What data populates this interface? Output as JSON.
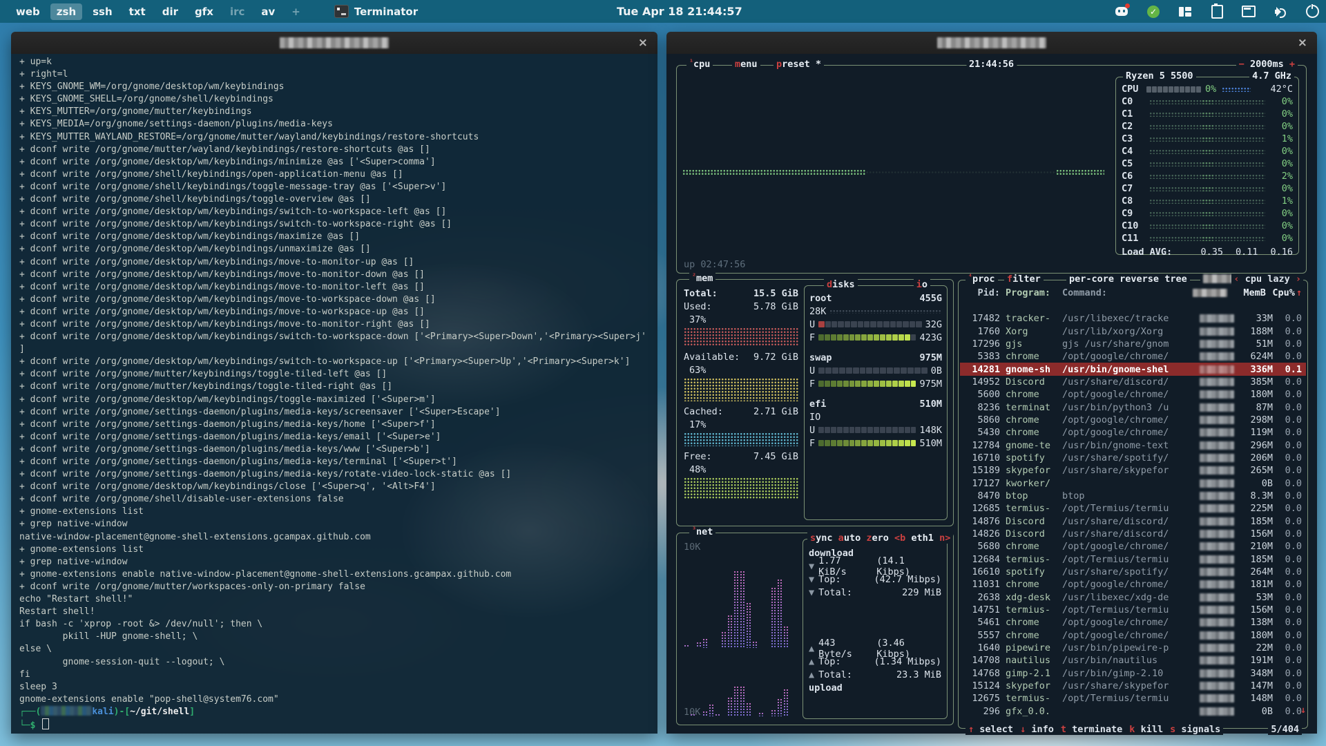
{
  "topbar": {
    "workspaces": [
      {
        "label": "web"
      },
      {
        "label": "zsh",
        "active": true
      },
      {
        "label": "ssh"
      },
      {
        "label": "txt"
      },
      {
        "label": "dir"
      },
      {
        "label": "gfx"
      },
      {
        "label": "irc",
        "dim": true
      },
      {
        "label": "av"
      },
      {
        "label": "+",
        "dim": true
      }
    ],
    "app_title": "Terminator",
    "clock": "Tue Apr 18  21:44:57",
    "tray_icons": [
      "discord-icon",
      "updates-ok-icon",
      "tiling-layout-icon",
      "clipboard-icon",
      "terminal-icon",
      "volume-icon",
      "power-icon"
    ]
  },
  "left_terminal": {
    "close_label": "×",
    "lines": [
      "+ up=k",
      "+ right=l",
      "+ KEYS_GNOME_WM=/org/gnome/desktop/wm/keybindings",
      "+ KEYS_GNOME_SHELL=/org/gnome/shell/keybindings",
      "+ KEYS_MUTTER=/org/gnome/mutter/keybindings",
      "+ KEYS_MEDIA=/org/gnome/settings-daemon/plugins/media-keys",
      "+ KEYS_MUTTER_WAYLAND_RESTORE=/org/gnome/mutter/wayland/keybindings/restore-shortcuts",
      "+ dconf write /org/gnome/mutter/wayland/keybindings/restore-shortcuts @as []",
      "+ dconf write /org/gnome/desktop/wm/keybindings/minimize @as ['<Super>comma']",
      "+ dconf write /org/gnome/shell/keybindings/open-application-menu @as []",
      "+ dconf write /org/gnome/shell/keybindings/toggle-message-tray @as ['<Super>v']",
      "+ dconf write /org/gnome/shell/keybindings/toggle-overview @as []",
      "+ dconf write /org/gnome/desktop/wm/keybindings/switch-to-workspace-left @as []",
      "+ dconf write /org/gnome/desktop/wm/keybindings/switch-to-workspace-right @as []",
      "+ dconf write /org/gnome/desktop/wm/keybindings/maximize @as []",
      "+ dconf write /org/gnome/desktop/wm/keybindings/unmaximize @as []",
      "+ dconf write /org/gnome/desktop/wm/keybindings/move-to-monitor-up @as []",
      "+ dconf write /org/gnome/desktop/wm/keybindings/move-to-monitor-down @as []",
      "+ dconf write /org/gnome/desktop/wm/keybindings/move-to-monitor-left @as []",
      "+ dconf write /org/gnome/desktop/wm/keybindings/move-to-workspace-down @as []",
      "+ dconf write /org/gnome/desktop/wm/keybindings/move-to-workspace-up @as []",
      "+ dconf write /org/gnome/desktop/wm/keybindings/move-to-monitor-right @as []",
      "+ dconf write /org/gnome/desktop/wm/keybindings/switch-to-workspace-down ['<Primary><Super>Down','<Primary><Super>j'",
      "]",
      "+ dconf write /org/gnome/desktop/wm/keybindings/switch-to-workspace-up ['<Primary><Super>Up','<Primary><Super>k']",
      "+ dconf write /org/gnome/mutter/keybindings/toggle-tiled-left @as []",
      "+ dconf write /org/gnome/mutter/keybindings/toggle-tiled-right @as []",
      "+ dconf write /org/gnome/desktop/wm/keybindings/toggle-maximized ['<Super>m']",
      "+ dconf write /org/gnome/settings-daemon/plugins/media-keys/screensaver ['<Super>Escape']",
      "+ dconf write /org/gnome/settings-daemon/plugins/media-keys/home ['<Super>f']",
      "+ dconf write /org/gnome/settings-daemon/plugins/media-keys/email ['<Super>e']",
      "+ dconf write /org/gnome/settings-daemon/plugins/media-keys/www ['<Super>b']",
      "+ dconf write /org/gnome/settings-daemon/plugins/media-keys/terminal ['<Super>t']",
      "+ dconf write /org/gnome/settings-daemon/plugins/media-keys/rotate-video-lock-static @as []",
      "+ dconf write /org/gnome/desktop/wm/keybindings/close ['<Super>q', '<Alt>F4']",
      "+ dconf write /org/gnome/shell/disable-user-extensions false",
      "+ gnome-extensions list",
      "+ grep native-window",
      "native-window-placement@gnome-shell-extensions.gcampax.github.com",
      "+ gnome-extensions list",
      "+ grep native-window",
      "+ gnome-extensions enable native-window-placement@gnome-shell-extensions.gcampax.github.com",
      "+ dconf write /org/gnome/mutter/workspaces-only-on-primary false",
      "echo \"Restart shell!\"",
      "Restart shell!",
      "if bash -c 'xprop -root &> /dev/null'; then \\",
      "        pkill -HUP gnome-shell; \\",
      "else \\",
      "        gnome-session-quit --logout; \\",
      "fi",
      "sleep 3",
      "gnome-extensions enable \"pop-shell@system76.com\""
    ],
    "prompt": {
      "frame_open": "┌──(",
      "host": "kali",
      "sep": ")-[",
      "path": "~/git/shell",
      "close_bracket": "]",
      "frame_bottom": "└─$"
    }
  },
  "btop": {
    "cpu": {
      "num": "¹",
      "title": "cpu",
      "menu_key": "m",
      "menu_rest": "enu",
      "preset_key": "p",
      "preset_rest": "reset *",
      "clock": "21:44:56",
      "interval_minus": "−",
      "interval": "2000ms",
      "interval_plus": "+",
      "model": "Ryzen 5 5500",
      "freq": "4.7 GHz",
      "cpu_label": "CPU",
      "cpu_pct": "0%",
      "temp": "42°C",
      "cores": [
        {
          "label": "C0",
          "pct": "0%"
        },
        {
          "label": "C1",
          "pct": "0%"
        },
        {
          "label": "C2",
          "pct": "0%"
        },
        {
          "label": "C3",
          "pct": "1%"
        },
        {
          "label": "C4",
          "pct": "0%"
        },
        {
          "label": "C5",
          "pct": "0%"
        },
        {
          "label": "C6",
          "pct": "2%"
        },
        {
          "label": "C7",
          "pct": "0%"
        },
        {
          "label": "C8",
          "pct": "1%"
        },
        {
          "label": "C9",
          "pct": "0%"
        },
        {
          "label": "C10",
          "pct": "0%"
        },
        {
          "label": "C11",
          "pct": "0%"
        }
      ],
      "load_label": "Load AVG:",
      "load": [
        "0.35",
        "0.11",
        "0.16"
      ],
      "uptime": "up 02:47:56"
    },
    "mem": {
      "num": "²",
      "title": "mem",
      "entries": [
        {
          "label": "Total:",
          "value": "15.5 GiB",
          "bold": true
        },
        {
          "label": "Used:",
          "value": "5.78 GiB",
          "pct": "37%",
          "color": "#c15959",
          "gh": 28
        },
        {
          "label": "Available:",
          "value": "9.72 GiB",
          "pct": "63%",
          "color": "#cdbd5e",
          "gh": 34
        },
        {
          "label": "Cached:",
          "value": "2.71 GiB",
          "pct": "17%",
          "color": "#5fb6cf",
          "gh": 20
        },
        {
          "label": "Free:",
          "value": "7.45 GiB",
          "pct": "48%",
          "color": "#a8c95c",
          "gh": 32
        }
      ]
    },
    "disks": {
      "title_key": "d",
      "title_rest": "isks",
      "io_key": "i",
      "io_rest": "o",
      "items": [
        {
          "name": "root",
          "size": "455G",
          "io": "28K",
          "io_dots": true,
          "used_value": "32G",
          "used_fill": 0.07,
          "free_value": "423G",
          "free_fill": 0.93
        },
        {
          "name": "swap",
          "size": "975M",
          "io": null,
          "used_value": "0B",
          "used_fill": 0.0,
          "free_value": "975M",
          "free_fill": 1.0
        },
        {
          "name": "efi",
          "size": "510M",
          "io": "IO",
          "io_dots": false,
          "used_value": "148K",
          "used_fill": 0.0,
          "free_value": "510M",
          "free_fill": 1.0
        }
      ],
      "u_label": "U",
      "f_label": "F"
    },
    "net": {
      "num": "³",
      "title": "net",
      "scale_top": "10K",
      "scale_bottom": "10K",
      "buttons": [
        {
          "key": "s",
          "rest": "ync"
        },
        {
          "key": "a",
          "rest": "uto"
        },
        {
          "key": "z",
          "rest": "ero"
        }
      ],
      "iface_left": "<b",
      "iface": "eth1",
      "iface_right": "n>",
      "download_label": "download",
      "upload_label": "upload",
      "down_stats": [
        {
          "arrow": "▼",
          "a": "1.77 KiB/s",
          "b": "(14.1 Kibps)"
        },
        {
          "arrow": "▼",
          "a": "Top:",
          "b": "(42.7 Mibps)"
        },
        {
          "arrow": "▼",
          "a": "Total:",
          "b": "229 MiB"
        }
      ],
      "up_stats": [
        {
          "arrow": "▲",
          "a": "443 Byte/s",
          "b": "(3.46 Kibps)"
        },
        {
          "arrow": "▲",
          "a": "Top:",
          "b": "(1.34 Mibps)"
        },
        {
          "arrow": "▲",
          "a": "Total:",
          "b": "23.3 MiB"
        }
      ],
      "down_bars": [
        5,
        0,
        9,
        14,
        0,
        0,
        24,
        48,
        112,
        112,
        66,
        10,
        0,
        0,
        88,
        100,
        32
      ],
      "up_bars": [
        0,
        4,
        0,
        8,
        18,
        4,
        0,
        28,
        44,
        44,
        20,
        0,
        6,
        0,
        10,
        26,
        40
      ]
    },
    "proc": {
      "num": "⁴",
      "title": "proc",
      "filter_key": "f",
      "filter_rest": "ilter",
      "options": [
        "per-core",
        "reverse",
        "tree"
      ],
      "sort_left": "‹",
      "sort": "cpu lazy",
      "sort_right": "›",
      "columns": {
        "pid": "Pid:",
        "program": "Program:",
        "command": "Command:",
        "mem": "MemB",
        "cpu": "Cpu%",
        "sort_arrow": "↑"
      },
      "rows": [
        {
          "pid": "17482",
          "prog": "tracker-",
          "cmd": "/usr/libexec/tracke",
          "mem": "33M",
          "cpu": "0.0"
        },
        {
          "pid": "1760",
          "prog": "Xorg",
          "cmd": "/usr/lib/xorg/Xorg",
          "mem": "188M",
          "cpu": "0.0"
        },
        {
          "pid": "17296",
          "prog": "gjs",
          "cmd": "gjs /usr/share/gnom",
          "mem": "51M",
          "cpu": "0.0"
        },
        {
          "pid": "5383",
          "prog": "chrome",
          "cmd": "/opt/google/chrome/",
          "mem": "624M",
          "cpu": "0.0"
        },
        {
          "pid": "14281",
          "prog": "gnome-sh",
          "cmd": "/usr/bin/gnome-shel",
          "mem": "336M",
          "cpu": "0.1",
          "selected": true
        },
        {
          "pid": "14952",
          "prog": "Discord",
          "cmd": "/usr/share/discord/",
          "mem": "385M",
          "cpu": "0.0"
        },
        {
          "pid": "5600",
          "prog": "chrome",
          "cmd": "/opt/google/chrome/",
          "mem": "180M",
          "cpu": "0.0"
        },
        {
          "pid": "8236",
          "prog": "terminat",
          "cmd": "/usr/bin/python3 /u",
          "mem": "87M",
          "cpu": "0.0"
        },
        {
          "pid": "5860",
          "prog": "chrome",
          "cmd": "/opt/google/chrome/",
          "mem": "298M",
          "cpu": "0.0"
        },
        {
          "pid": "5430",
          "prog": "chrome",
          "cmd": "/opt/google/chrome/",
          "mem": "119M",
          "cpu": "0.0"
        },
        {
          "pid": "12784",
          "prog": "gnome-te",
          "cmd": "/usr/bin/gnome-text",
          "mem": "296M",
          "cpu": "0.0"
        },
        {
          "pid": "16710",
          "prog": "spotify",
          "cmd": "/usr/share/spotify/",
          "mem": "206M",
          "cpu": "0.0"
        },
        {
          "pid": "15189",
          "prog": "skypefor",
          "cmd": "/usr/share/skypefor",
          "mem": "265M",
          "cpu": "0.0"
        },
        {
          "pid": "17127",
          "prog": "kworker/",
          "cmd": "",
          "mem": "0B",
          "cpu": "0.0"
        },
        {
          "pid": "8470",
          "prog": "btop",
          "cmd": "btop",
          "mem": "8.3M",
          "cpu": "0.0"
        },
        {
          "pid": "12685",
          "prog": "termius-",
          "cmd": "/opt/Termius/termiu",
          "mem": "225M",
          "cpu": "0.0"
        },
        {
          "pid": "14876",
          "prog": "Discord",
          "cmd": "/usr/share/discord/",
          "mem": "185M",
          "cpu": "0.0"
        },
        {
          "pid": "14826",
          "prog": "Discord",
          "cmd": "/usr/share/discord/",
          "mem": "156M",
          "cpu": "0.0"
        },
        {
          "pid": "5680",
          "prog": "chrome",
          "cmd": "/opt/google/chrome/",
          "mem": "210M",
          "cpu": "0.0"
        },
        {
          "pid": "12684",
          "prog": "termius-",
          "cmd": "/opt/Termius/termiu",
          "mem": "185M",
          "cpu": "0.0"
        },
        {
          "pid": "16610",
          "prog": "spotify",
          "cmd": "/usr/share/spotify/",
          "mem": "264M",
          "cpu": "0.0"
        },
        {
          "pid": "11031",
          "prog": "chrome",
          "cmd": "/opt/google/chrome/",
          "mem": "181M",
          "cpu": "0.0"
        },
        {
          "pid": "2638",
          "prog": "xdg-desk",
          "cmd": "/usr/libexec/xdg-de",
          "mem": "53M",
          "cpu": "0.0"
        },
        {
          "pid": "14751",
          "prog": "termius-",
          "cmd": "/opt/Termius/termiu",
          "mem": "156M",
          "cpu": "0.0"
        },
        {
          "pid": "5461",
          "prog": "chrome",
          "cmd": "/opt/google/chrome/",
          "mem": "138M",
          "cpu": "0.0"
        },
        {
          "pid": "5557",
          "prog": "chrome",
          "cmd": "/opt/google/chrome/",
          "mem": "180M",
          "cpu": "0.0"
        },
        {
          "pid": "1640",
          "prog": "pipewire",
          "cmd": "/usr/bin/pipewire-p",
          "mem": "22M",
          "cpu": "0.0"
        },
        {
          "pid": "14708",
          "prog": "nautilus",
          "cmd": "/usr/bin/nautilus",
          "mem": "191M",
          "cpu": "0.0"
        },
        {
          "pid": "14768",
          "prog": "gimp-2.1",
          "cmd": "/usr/bin/gimp-2.10",
          "mem": "348M",
          "cpu": "0.0"
        },
        {
          "pid": "15124",
          "prog": "skypefor",
          "cmd": "/usr/share/skypefor",
          "mem": "147M",
          "cpu": "0.0"
        },
        {
          "pid": "12675",
          "prog": "termius-",
          "cmd": "/opt/Termius/termiu",
          "mem": "148M",
          "cpu": "0.0"
        },
        {
          "pid": "296",
          "prog": "gfx_0.0.",
          "cmd": "",
          "mem": "0B",
          "cpu": "0.0"
        }
      ],
      "footer": [
        {
          "key": "↑",
          "label": "select"
        },
        {
          "key": "↓",
          "label": "info"
        },
        {
          "key": "t",
          "label": "terminate"
        },
        {
          "key": "k",
          "label": "kill"
        },
        {
          "key": "s",
          "label": "signals"
        }
      ],
      "count": "5/404",
      "scroll_up": "↑",
      "scroll_down": "↓"
    }
  }
}
